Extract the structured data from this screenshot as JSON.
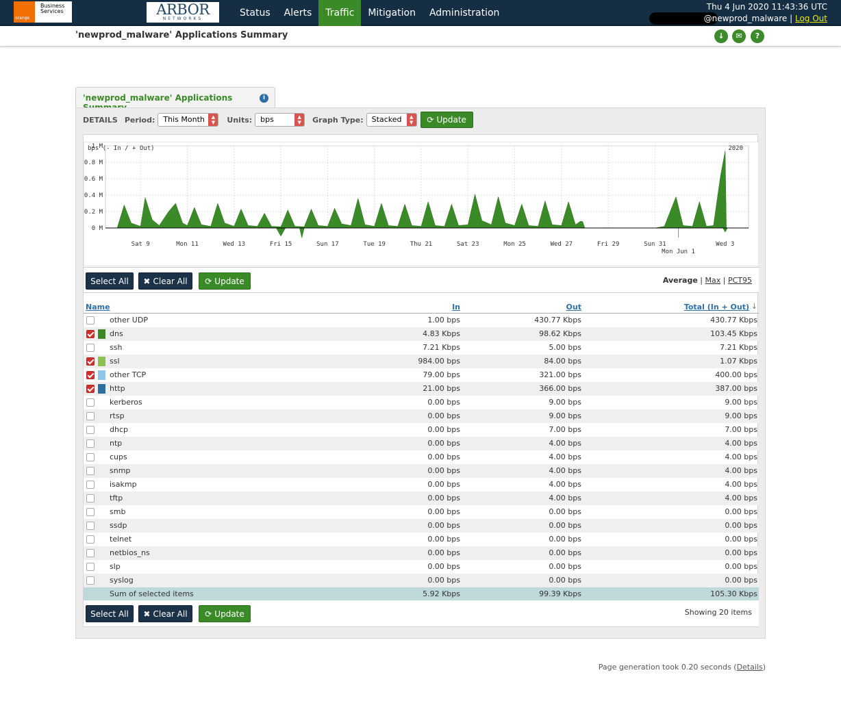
{
  "brand": {
    "orange_small": "orange",
    "orange_line1": "Business",
    "orange_line2": "Services",
    "arbor_title": "ARBOR",
    "arbor_sub": "NETWORKS"
  },
  "nav": {
    "items": [
      "Status",
      "Alerts",
      "Traffic",
      "Mitigation",
      "Administration"
    ],
    "active": "Traffic"
  },
  "user": {
    "datetime": "Thu 4 Jun 2020 11:43:36 UTC",
    "username": "@newprod_malware",
    "separator": "|",
    "logout": "Log Out"
  },
  "page": {
    "title": "'newprod_malware' Applications Summary",
    "tab_title": "'newprod_malware' Applications Summary",
    "info_icon": "i"
  },
  "header_buttons": {
    "download_icon": "↓",
    "email_icon": "✉",
    "help_icon": "?"
  },
  "details": {
    "label": "DETAILS",
    "period_label": "Period:",
    "period_value": "This Month",
    "units_label": "Units:",
    "units_value": "bps",
    "graph_type_label": "Graph Type:",
    "graph_type_value": "Stacked",
    "update_label": "Update"
  },
  "chart_data": {
    "type": "area",
    "stacked": true,
    "y_label": "bps (- In / + Out)",
    "year_label": "2020",
    "y_ticks": [
      "1 M",
      "0.8 M",
      "0.6 M",
      "0.4 M",
      "0.2 M",
      "0 M"
    ],
    "y_tick_values": [
      1000000,
      800000,
      600000,
      400000,
      200000,
      0
    ],
    "ylim": [
      0,
      1000000
    ],
    "x_ticks": [
      "Sat 9",
      "Mon 11",
      "Wed 13",
      "Fri 15",
      "Sun 17",
      "Tue 19",
      "Thu 21",
      "Sat 23",
      "Mon 25",
      "Wed 27",
      "Fri 29",
      "Sun 31",
      "Wed 3"
    ],
    "x_sub_tick": "Mon Jun 1",
    "xlim_days": [
      7.5,
      35.0
    ],
    "x_tick_days": [
      9,
      11,
      13,
      15,
      17,
      19,
      21,
      23,
      25,
      27,
      29,
      31,
      34
    ],
    "x_sub_tick_day": 32,
    "grid": true,
    "fill_color": "#3b8a28",
    "series": [
      {
        "out_points": [
          [
            8.0,
            0
          ],
          [
            8.3,
            280000
          ],
          [
            8.6,
            60000
          ],
          [
            9.0,
            20000
          ],
          [
            9.2,
            370000
          ],
          [
            9.5,
            100000
          ],
          [
            9.8,
            30000
          ],
          [
            10.2,
            200000
          ],
          [
            10.5,
            300000
          ],
          [
            10.8,
            60000
          ],
          [
            11.0,
            30000
          ],
          [
            11.3,
            250000
          ],
          [
            11.6,
            40000
          ],
          [
            12.0,
            20000
          ],
          [
            12.3,
            300000
          ],
          [
            12.6,
            60000
          ],
          [
            13.0,
            20000
          ],
          [
            13.3,
            230000
          ],
          [
            13.6,
            30000
          ],
          [
            14.0,
            20000
          ],
          [
            14.3,
            180000
          ],
          [
            14.6,
            20000
          ],
          [
            15.0,
            15000
          ],
          [
            15.3,
            220000
          ],
          [
            15.6,
            20000
          ],
          [
            16.0,
            15000
          ],
          [
            16.3,
            230000
          ],
          [
            16.6,
            30000
          ],
          [
            17.0,
            20000
          ],
          [
            17.3,
            240000
          ],
          [
            17.6,
            50000
          ],
          [
            18.0,
            30000
          ],
          [
            18.3,
            360000
          ],
          [
            18.6,
            40000
          ],
          [
            19.0,
            20000
          ],
          [
            19.3,
            300000
          ],
          [
            19.6,
            30000
          ],
          [
            20.0,
            20000
          ],
          [
            20.3,
            290000
          ],
          [
            20.6,
            30000
          ],
          [
            21.0,
            20000
          ],
          [
            21.3,
            320000
          ],
          [
            21.6,
            30000
          ],
          [
            22.0,
            20000
          ],
          [
            22.3,
            290000
          ],
          [
            22.6,
            30000
          ],
          [
            23.0,
            40000
          ],
          [
            23.3,
            410000
          ],
          [
            23.6,
            90000
          ],
          [
            24.0,
            40000
          ],
          [
            24.3,
            380000
          ],
          [
            24.6,
            60000
          ],
          [
            25.0,
            30000
          ],
          [
            25.3,
            290000
          ],
          [
            25.6,
            30000
          ],
          [
            26.0,
            20000
          ],
          [
            26.3,
            330000
          ],
          [
            26.6,
            40000
          ],
          [
            27.0,
            30000
          ],
          [
            27.3,
            320000
          ],
          [
            27.6,
            40000
          ],
          [
            27.8,
            80000
          ],
          [
            27.9,
            80000
          ],
          [
            28.0,
            0
          ],
          [
            31.0,
            0
          ],
          [
            31.4,
            20000
          ],
          [
            31.9,
            380000
          ],
          [
            32.2,
            30000
          ],
          [
            32.6,
            20000
          ],
          [
            32.9,
            320000
          ],
          [
            33.2,
            20000
          ],
          [
            33.5,
            30000
          ],
          [
            33.8,
            630000
          ],
          [
            34.0,
            940000
          ],
          [
            34.05,
            0
          ]
        ],
        "in_points": [
          [
            14.8,
            0
          ],
          [
            15.0,
            -100000
          ],
          [
            15.2,
            0
          ],
          [
            15.8,
            0
          ],
          [
            15.9,
            -120000
          ],
          [
            16.0,
            0
          ],
          [
            33.9,
            0
          ],
          [
            34.0,
            -50000
          ],
          [
            34.1,
            0
          ]
        ]
      }
    ]
  },
  "actions": {
    "select_all": "Select All",
    "clear_all": "Clear All",
    "update": "Update",
    "stat_average": "Average",
    "stat_max": "Max",
    "stat_pct95": "PCT95",
    "sep": "|",
    "showing": "Showing 20 items"
  },
  "table": {
    "headers": {
      "name": "Name",
      "in": "In",
      "out": "Out",
      "total": "Total (In + Out)"
    },
    "rows": [
      {
        "name": "other UDP",
        "in": "1.00 bps",
        "out": "430.77 Kbps",
        "total": "430.77 Kbps",
        "checked": false,
        "color": ""
      },
      {
        "name": "dns",
        "in": "4.83 Kbps",
        "out": "98.62 Kbps",
        "total": "103.45 Kbps",
        "checked": true,
        "color": "#3b8a28"
      },
      {
        "name": "ssh",
        "in": "7.21 Kbps",
        "out": "5.00 bps",
        "total": "7.21 Kbps",
        "checked": false,
        "color": ""
      },
      {
        "name": "ssl",
        "in": "984.00 bps",
        "out": "84.00 bps",
        "total": "1.07 Kbps",
        "checked": true,
        "color": "#8cc04f"
      },
      {
        "name": "other TCP",
        "in": "79.00 bps",
        "out": "321.00 bps",
        "total": "400.00 bps",
        "checked": true,
        "color": "#8fc6e8"
      },
      {
        "name": "http",
        "in": "21.00 bps",
        "out": "366.00 bps",
        "total": "387.00 bps",
        "checked": true,
        "color": "#2f6f9f"
      },
      {
        "name": "kerberos",
        "in": "0.00 bps",
        "out": "9.00 bps",
        "total": "9.00 bps",
        "checked": false,
        "color": ""
      },
      {
        "name": "rtsp",
        "in": "0.00 bps",
        "out": "9.00 bps",
        "total": "9.00 bps",
        "checked": false,
        "color": ""
      },
      {
        "name": "dhcp",
        "in": "0.00 bps",
        "out": "7.00 bps",
        "total": "7.00 bps",
        "checked": false,
        "color": ""
      },
      {
        "name": "ntp",
        "in": "0.00 bps",
        "out": "4.00 bps",
        "total": "4.00 bps",
        "checked": false,
        "color": ""
      },
      {
        "name": "cups",
        "in": "0.00 bps",
        "out": "4.00 bps",
        "total": "4.00 bps",
        "checked": false,
        "color": ""
      },
      {
        "name": "snmp",
        "in": "0.00 bps",
        "out": "4.00 bps",
        "total": "4.00 bps",
        "checked": false,
        "color": ""
      },
      {
        "name": "isakmp",
        "in": "0.00 bps",
        "out": "4.00 bps",
        "total": "4.00 bps",
        "checked": false,
        "color": ""
      },
      {
        "name": "tftp",
        "in": "0.00 bps",
        "out": "4.00 bps",
        "total": "4.00 bps",
        "checked": false,
        "color": ""
      },
      {
        "name": "smb",
        "in": "0.00 bps",
        "out": "0.00 bps",
        "total": "0.00 bps",
        "checked": false,
        "color": ""
      },
      {
        "name": "ssdp",
        "in": "0.00 bps",
        "out": "0.00 bps",
        "total": "0.00 bps",
        "checked": false,
        "color": ""
      },
      {
        "name": "telnet",
        "in": "0.00 bps",
        "out": "0.00 bps",
        "total": "0.00 bps",
        "checked": false,
        "color": ""
      },
      {
        "name": "netbios_ns",
        "in": "0.00 bps",
        "out": "0.00 bps",
        "total": "0.00 bps",
        "checked": false,
        "color": ""
      },
      {
        "name": "slp",
        "in": "0.00 bps",
        "out": "0.00 bps",
        "total": "0.00 bps",
        "checked": false,
        "color": ""
      },
      {
        "name": "syslog",
        "in": "0.00 bps",
        "out": "0.00 bps",
        "total": "0.00 bps",
        "checked": false,
        "color": ""
      }
    ],
    "sum": {
      "name": "Sum of selected items",
      "in": "5.92 Kbps",
      "out": "99.39 Kbps",
      "total": "105.30 Kbps"
    }
  },
  "footer": {
    "text": "Page generation took 0.20 seconds (",
    "link": "Details",
    "close": ")"
  }
}
